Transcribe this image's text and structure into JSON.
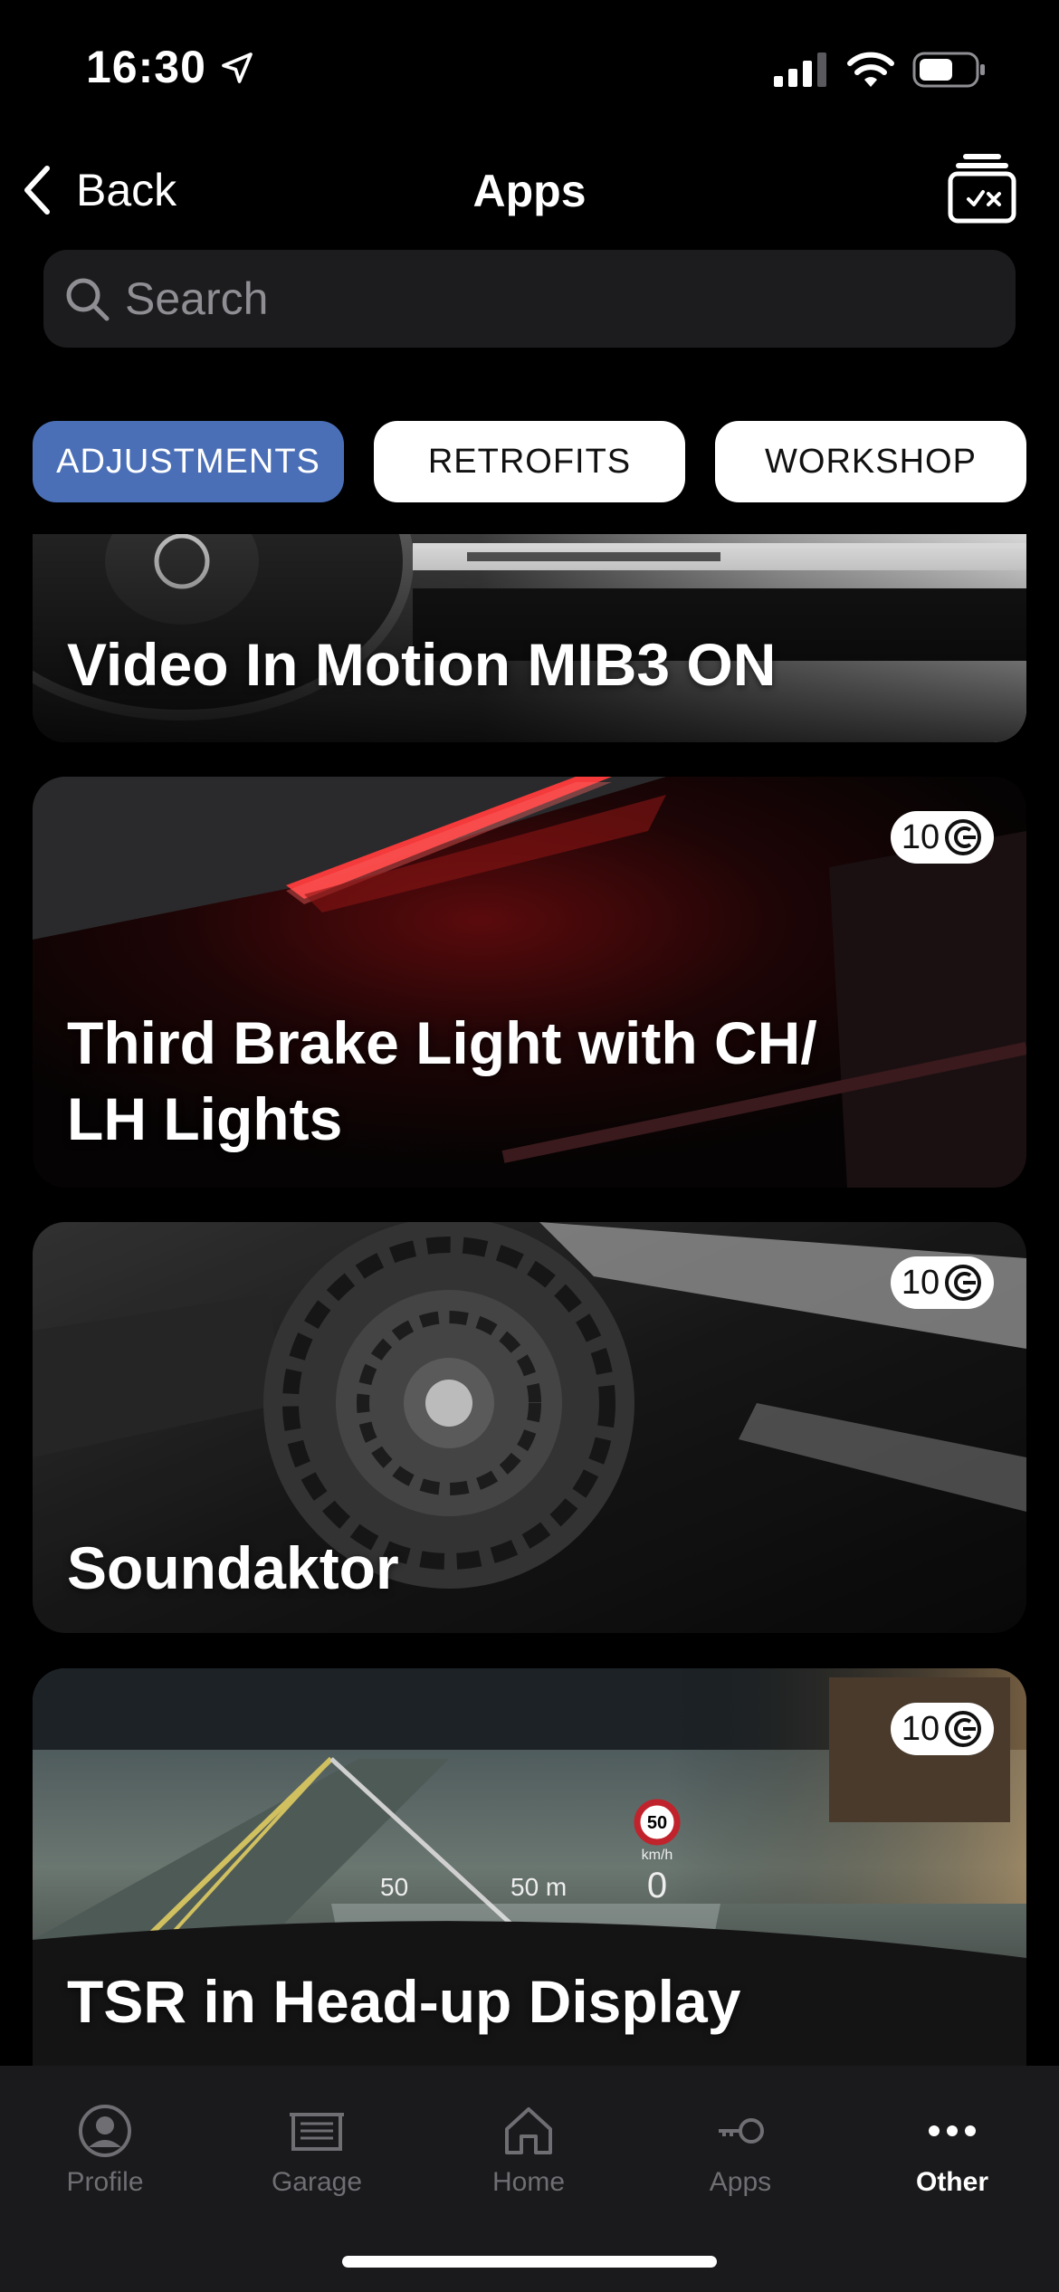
{
  "status_bar": {
    "time": "16:30"
  },
  "nav": {
    "back_label": "Back",
    "title": "Apps"
  },
  "search": {
    "placeholder": "Search",
    "value": ""
  },
  "tabs": [
    {
      "label": "ADJUSTMENTS",
      "active": true
    },
    {
      "label": "RETROFITS",
      "active": false
    },
    {
      "label": "WORKSHOP",
      "active": false
    }
  ],
  "cards": [
    {
      "title_line1": "Video In Motion MIB3 ON",
      "title_line2": "",
      "price": ""
    },
    {
      "title_line1": "Third Brake Light with CH/",
      "title_line2": "LH Lights",
      "price": "10"
    },
    {
      "title_line1": "Soundaktor",
      "title_line2": "",
      "price": "10"
    },
    {
      "title_line1": "TSR in Head-up Display",
      "title_line2": "",
      "price": "10"
    }
  ],
  "hud": {
    "speed_limit": "50",
    "unit": "km/h",
    "current_speed": "0",
    "cruise": "50",
    "distance": "50 m"
  },
  "tabbar": [
    {
      "label": "Profile",
      "icon": "person-circle-icon",
      "active": false
    },
    {
      "label": "Garage",
      "icon": "garage-icon",
      "active": false
    },
    {
      "label": "Home",
      "icon": "home-icon",
      "active": false
    },
    {
      "label": "Apps",
      "icon": "apps-key-icon",
      "active": false
    },
    {
      "label": "Other",
      "icon": "more-dots-icon",
      "active": true
    }
  ],
  "colors": {
    "accent": "#4a6fb7",
    "background": "#000000",
    "tabbar": "#1a1a1c",
    "inactive": "#6e6e73"
  }
}
